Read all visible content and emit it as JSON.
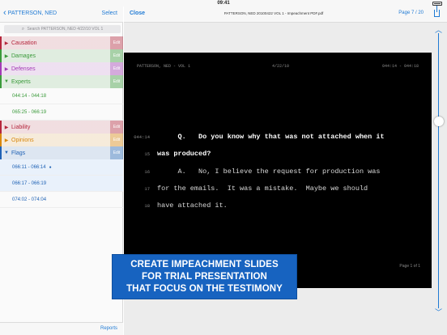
{
  "status": {
    "time": "09:41"
  },
  "left": {
    "back_label": "PATTERSON, NED",
    "select_label": "Select",
    "search_placeholder": "Search PATTERSON, NED 4/22/10 VOL 1",
    "edit_label": "Edit",
    "categories": [
      {
        "name": "Causation",
        "color": "#b5263c",
        "expanded": false
      },
      {
        "name": "Damages",
        "color": "#3a9a3a",
        "expanded": false
      },
      {
        "name": "Defenses",
        "color": "#a33bb5",
        "expanded": false
      },
      {
        "name": "Experts",
        "color": "#3a9a3a",
        "expanded": true,
        "clips": [
          "044:14 - 044:18",
          "065:25 - 066:19"
        ]
      },
      {
        "name": "Liability",
        "color": "#b5263c",
        "expanded": false
      },
      {
        "name": "Opinions",
        "color": "#d9890f",
        "expanded": false
      },
      {
        "name": "Flags",
        "color": "#1f62b5",
        "expanded": true,
        "clips": [
          "066:11 - 066:14",
          "066:17 - 066:19",
          "074:02 - 074:04"
        ]
      }
    ],
    "reports_label": "Reports"
  },
  "right": {
    "close_label": "Close",
    "doc_title": "PATTERSON, NED 20100422 VOL 1 - Impeachment PDF.pdf",
    "page_indicator": "Page 7 / 20",
    "slide": {
      "header_left": "PATTERSON, NED - VOL 1",
      "header_mid": "4/22/10",
      "header_right": "044:14 - 044:18",
      "lines": [
        {
          "num": "044:14",
          "text": "     Q.   Do you know why that was not attached when it",
          "bold": true
        },
        {
          "num": "15",
          "text": "was produced?",
          "bold": true
        },
        {
          "num": "16",
          "text": "     A.   No, I believe the request for production was",
          "bold": false
        },
        {
          "num": "17",
          "text": "for the emails.  It was a mistake.  Maybe we should",
          "bold": false
        },
        {
          "num": "18",
          "text": "have attached it.",
          "bold": false
        }
      ],
      "page_of": "Page 1 of 1"
    }
  },
  "banner": {
    "lines": [
      "CREATE IMPEACHMENT SLIDES",
      "FOR TRIAL PRESENTATION",
      "THAT FOCUS ON THE TESTIMONY"
    ],
    "color": "#1763c0"
  }
}
